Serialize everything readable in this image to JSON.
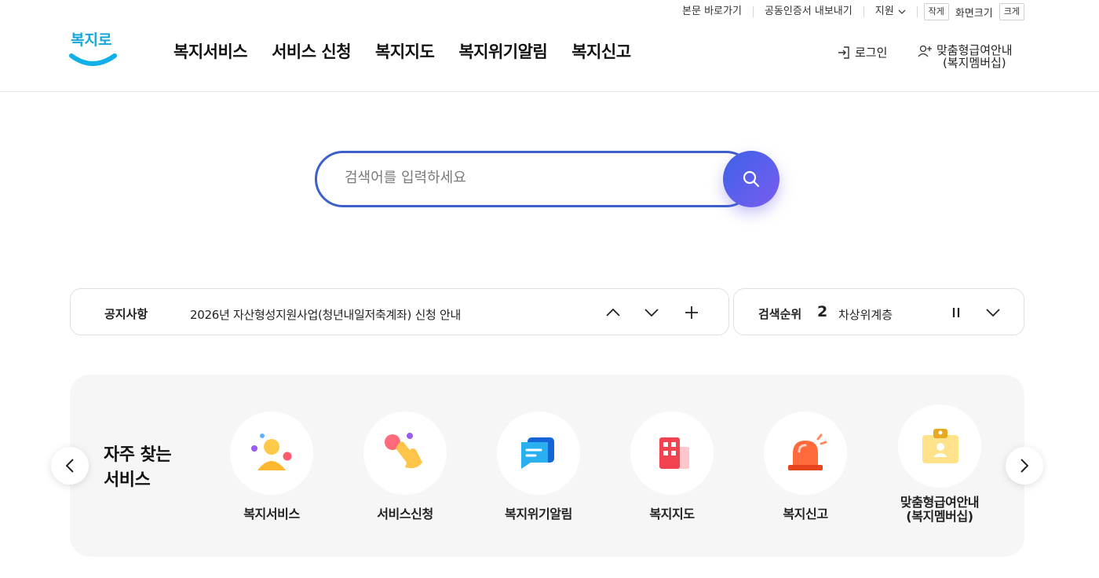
{
  "utility": {
    "skip": "본문 바로가기",
    "cert": "공동인증서 내보내기",
    "support": "지원",
    "size_small": "작게",
    "size_label": "화면크기",
    "size_large": "크게"
  },
  "logo": {
    "text": "복지로"
  },
  "gnb": [
    "복지서비스",
    "서비스 신청",
    "복지지도",
    "복지위기알림",
    "복지신고"
  ],
  "account": {
    "login": "로그인",
    "member_line1": "맞춤형급여안내",
    "member_line2": "(복지멤버십)"
  },
  "search": {
    "placeholder": "검색어를 입력하세요"
  },
  "notice": {
    "label": "공지사항",
    "text": "2026년 자산형성지원사업(청년내일저축계좌) 신청 안내"
  },
  "rank": {
    "label": "검색순위",
    "number": "2",
    "keyword": "차상위계층"
  },
  "quick": {
    "title_line1": "자주 찾는",
    "title_line2": "서비스",
    "items": [
      {
        "label": "복지서비스",
        "icon": "person-icon"
      },
      {
        "label": "서비스신청",
        "icon": "hand-touch-icon"
      },
      {
        "label": "복지위기알림",
        "icon": "message-icon"
      },
      {
        "label": "복지지도",
        "icon": "building-icon"
      },
      {
        "label": "복지신고",
        "icon": "siren-icon"
      },
      {
        "label": "맞춤형급여안내\n(복지멤버십)",
        "icon": "id-card-icon"
      }
    ]
  }
}
